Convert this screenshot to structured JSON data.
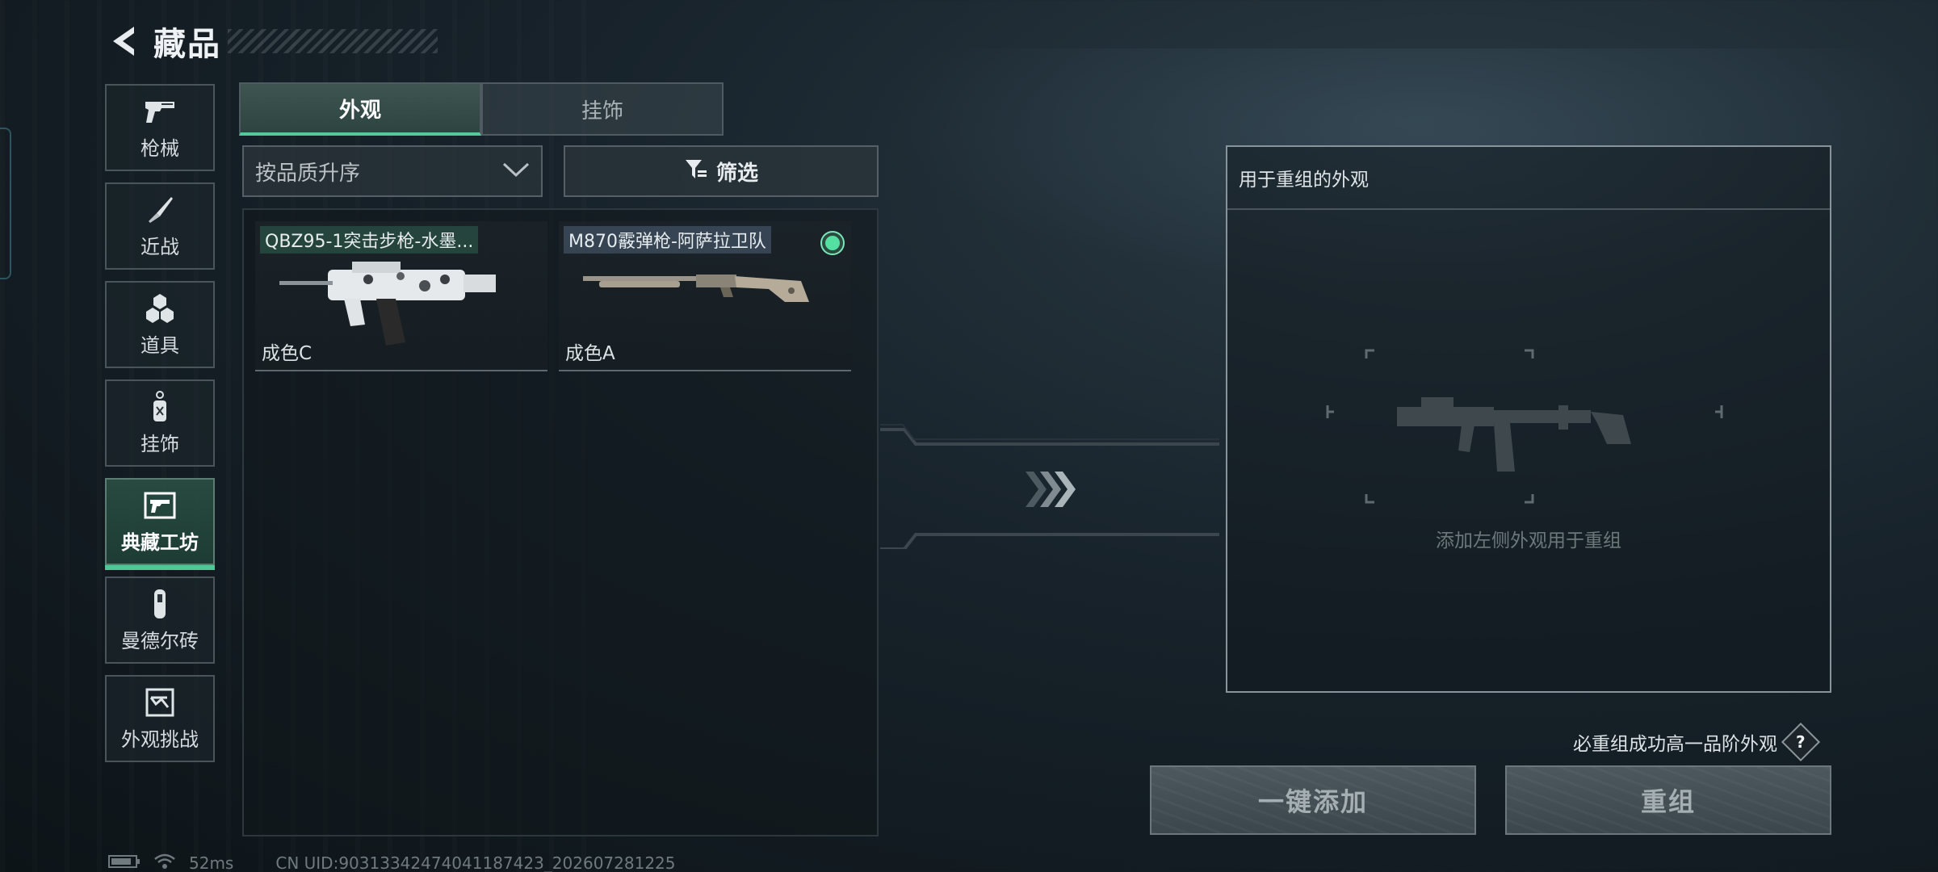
{
  "header": {
    "title": "藏品"
  },
  "sidebar": {
    "items": [
      {
        "label": "枪械",
        "icon": "pistol-icon"
      },
      {
        "label": "近战",
        "icon": "knife-icon"
      },
      {
        "label": "道具",
        "icon": "grenade-icon"
      },
      {
        "label": "挂饰",
        "icon": "charm-icon"
      },
      {
        "label": "典藏工坊",
        "icon": "workshop-icon",
        "active": true
      },
      {
        "label": "曼德尔砖",
        "icon": "brick-icon"
      },
      {
        "label": "外观挑战",
        "icon": "challenge-icon"
      }
    ]
  },
  "tabs": [
    {
      "label": "外观",
      "active": true
    },
    {
      "label": "挂饰",
      "active": false
    }
  ],
  "sort": {
    "value": "按品质升序"
  },
  "filter": {
    "label": "筛选"
  },
  "items": [
    {
      "name": "QBZ95-1突击步枪-水墨...",
      "grade": "成色C",
      "selected": false
    },
    {
      "name": "M870霰弹枪-阿萨拉卫队",
      "grade": "成色A",
      "selected": true
    }
  ],
  "recombine": {
    "title": "用于重组的外观",
    "placeholder": "添加左侧外观用于重组",
    "hint": "必重组成功高一品阶外观",
    "help_label": "?",
    "add_all_label": "一键添加",
    "recombine_label": "重组"
  },
  "status": {
    "ping": "52ms",
    "uid": "CN UID:90313342474041187423_202607281225"
  },
  "colors": {
    "accent": "#4fc896",
    "active_tab_bg": "#3f5854",
    "selected_dot": "#54e0a0"
  }
}
